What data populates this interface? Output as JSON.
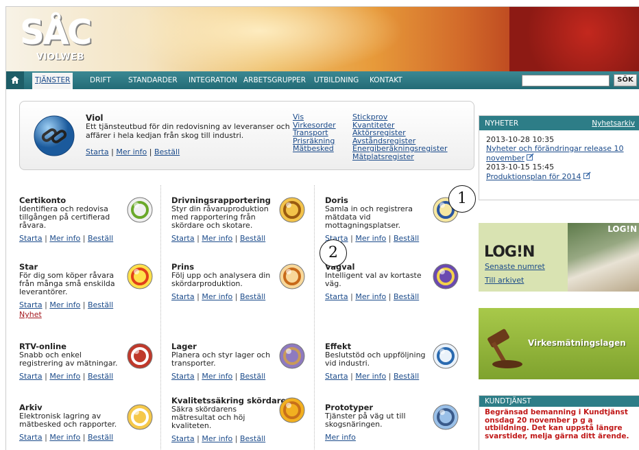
{
  "header": {
    "logo_mark": "SÅC",
    "logo_sub": "VIOLWEB"
  },
  "nav": {
    "items": [
      "TJÄNSTER",
      "DRIFT",
      "STANDARDER",
      "INTEGRATION",
      "ARBETSGRUPPER",
      "UTBILDNING",
      "KONTAKT"
    ],
    "search_placeholder": "",
    "search_button": "SÖK"
  },
  "viol": {
    "title": "Viol",
    "description": "Ett tjänsteutbud för din redovisning av leveranser och affärer i hela kedjan från skog till industri.",
    "actions": [
      "Starta",
      "Mer info",
      "Beställ"
    ],
    "col1": [
      "Vis",
      "Virkesorder",
      "Transport",
      "Prisräkning",
      "Mätbesked"
    ],
    "col2": [
      "Stickprov",
      "Kvantiteter",
      "Aktörsregister",
      "Avståndsregister",
      "Energiberäkningsregister",
      "Mätplatsregister"
    ]
  },
  "services": [
    {
      "title": "Certikonto",
      "desc": "Identifiera och redovisa tillgången på certifierad råvara.",
      "actions": [
        "Starta",
        "Mer info",
        "Beställ"
      ],
      "icon": "certificate-check-icon"
    },
    {
      "title": "Drivningsrapportering",
      "desc": "Styr din råvaruproduktion med rapportering från skördare och skotare.",
      "actions": [
        "Starta",
        "Mer info",
        "Beställ"
      ],
      "icon": "log-arrow-icon"
    },
    {
      "title": "Doris",
      "desc": "Samla in och registrera mätdata vid mottagningsplatser.",
      "actions": [
        "Starta",
        "Mer info",
        "Beställ"
      ],
      "icon": "pen-pad-icon"
    },
    {
      "title": "Star",
      "desc": "För dig som köper råvara från många små enskilda leverantörer.",
      "actions": [
        "Starta",
        "Mer info",
        "Beställ"
      ],
      "extra": "Nyhet",
      "icon": "sun-star-icon"
    },
    {
      "title": "Prins",
      "desc": "Följ upp och analysera din skördarproduktion.",
      "actions": [
        "Starta",
        "Mer info",
        "Beställ"
      ],
      "icon": "chart-document-icon"
    },
    {
      "title": "Vägval",
      "desc": "Intelligent val av kortaste väg.",
      "actions": [
        "Starta",
        "Mer info",
        "Beställ"
      ],
      "icon": "crown-road-icon"
    },
    {
      "title": "RTV-online",
      "desc": "Snabb och enkel registrering av mätningar.",
      "actions": [
        "Starta",
        "Mer info",
        "Beställ"
      ],
      "icon": "dots-grid-icon"
    },
    {
      "title": "Lager",
      "desc": "Planera och styr lager och transporter.",
      "actions": [
        "Starta",
        "Mer info",
        "Beställ"
      ],
      "icon": "log-pile-icon"
    },
    {
      "title": "Effekt",
      "desc": "Beslutstöd och uppföljning vid industri.",
      "actions": [
        "Starta",
        "Mer info",
        "Beställ"
      ],
      "icon": "target-icon"
    },
    {
      "title": "Arkiv",
      "desc": "Elektronisk lagring av mätbesked och rapporter.",
      "actions": [
        "Starta",
        "Mer info",
        "Beställ"
      ],
      "icon": "drawer-icon"
    },
    {
      "title": "Kvalitetssäkring skördare",
      "desc": "Säkra skördarens mätresultat och höj kvaliteten.",
      "actions": [
        "Starta",
        "Mer info",
        "Beställ"
      ],
      "icon": "quality-q-icon"
    },
    {
      "title": "Prototyper",
      "desc": "Tjänster på väg ut till skogsnäringen.",
      "actions": [
        "Mer info"
      ],
      "icon": "hammer-icon"
    }
  ],
  "news": {
    "heading": "NYHETER",
    "archive": "Nyhetsarkiv",
    "items": [
      {
        "date": "2013-10-28 10:35",
        "title": "Nyheter och förändringar release 10 november"
      },
      {
        "date": "2013-10-15 15:45",
        "title": "Produktionsplan för 2014"
      }
    ]
  },
  "login": {
    "logo": "LOG!N",
    "latest": "Senaste numret",
    "archive": "Till arkivet",
    "mag_label": "LOG!N"
  },
  "virke": {
    "label": "Virkesmätningslagen"
  },
  "kund": {
    "heading": "KUNDTJÄNST",
    "text": "Begränsad bemanning i Kundtjänst onsdag 20 november p g a utbildning. Det kan uppstå längre svarstider, melja gärna ditt ärende."
  },
  "markers": [
    "1",
    "2"
  ]
}
